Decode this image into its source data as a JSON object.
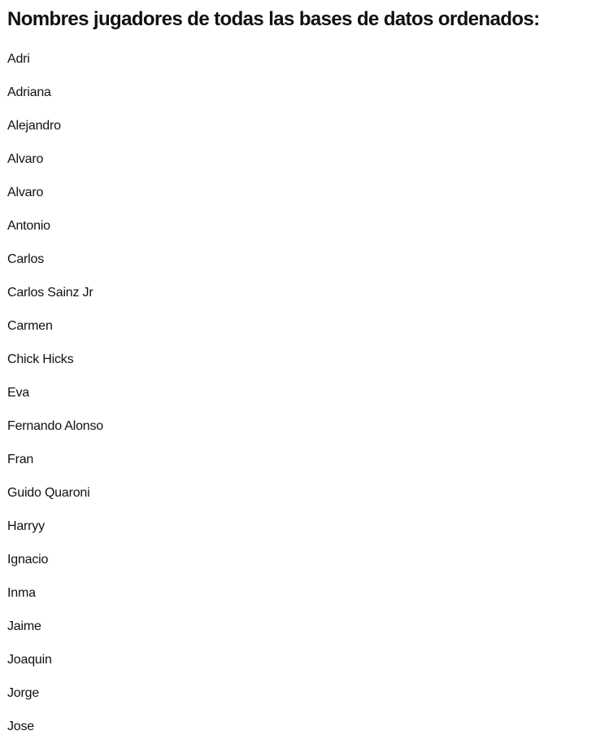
{
  "title": "Nombres jugadores de todas las bases de datos ordenados:",
  "players": [
    "Adri",
    "Adriana",
    "Alejandro",
    "Alvaro",
    "Alvaro",
    "Antonio",
    "Carlos",
    "Carlos Sainz Jr",
    "Carmen",
    "Chick Hicks",
    "Eva",
    "Fernando Alonso",
    "Fran",
    "Guido Quaroni",
    "Harryy",
    "Ignacio",
    "Inma",
    "Jaime",
    "Joaquin",
    "Jorge",
    "Jose"
  ]
}
